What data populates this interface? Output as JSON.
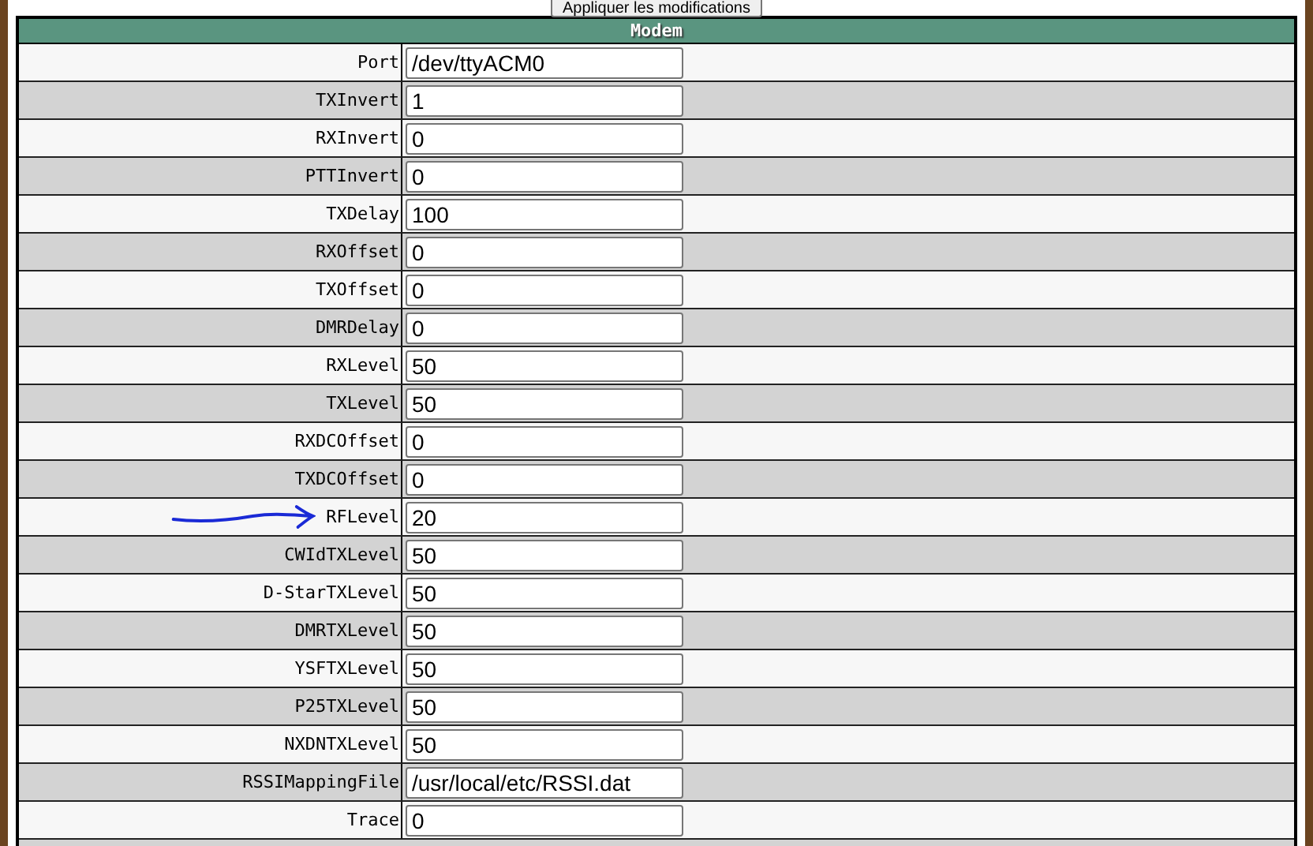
{
  "apply_button": "Appliquer les modifications",
  "section": {
    "title": "Modem"
  },
  "rows": [
    {
      "label": "Port",
      "value": "/dev/ttyACM0",
      "arrow": false
    },
    {
      "label": "TXInvert",
      "value": "1",
      "arrow": false
    },
    {
      "label": "RXInvert",
      "value": "0",
      "arrow": false
    },
    {
      "label": "PTTInvert",
      "value": "0",
      "arrow": false
    },
    {
      "label": "TXDelay",
      "value": "100",
      "arrow": false
    },
    {
      "label": "RXOffset",
      "value": "0",
      "arrow": false
    },
    {
      "label": "TXOffset",
      "value": "0",
      "arrow": false
    },
    {
      "label": "DMRDelay",
      "value": "0",
      "arrow": false
    },
    {
      "label": "RXLevel",
      "value": "50",
      "arrow": false
    },
    {
      "label": "TXLevel",
      "value": "50",
      "arrow": false
    },
    {
      "label": "RXDCOffset",
      "value": "0",
      "arrow": false
    },
    {
      "label": "TXDCOffset",
      "value": "0",
      "arrow": false
    },
    {
      "label": "RFLevel",
      "value": "20",
      "arrow": true
    },
    {
      "label": "CWIdTXLevel",
      "value": "50",
      "arrow": false
    },
    {
      "label": "D-StarTXLevel",
      "value": "50",
      "arrow": false
    },
    {
      "label": "DMRTXLevel",
      "value": "50",
      "arrow": false
    },
    {
      "label": "YSFTXLevel",
      "value": "50",
      "arrow": false
    },
    {
      "label": "P25TXLevel",
      "value": "50",
      "arrow": false
    },
    {
      "label": "NXDNTXLevel",
      "value": "50",
      "arrow": false
    },
    {
      "label": "RSSIMappingFile",
      "value": "/usr/local/etc/RSSI.dat",
      "arrow": false
    },
    {
      "label": "Trace",
      "value": "0",
      "arrow": false
    }
  ]
}
